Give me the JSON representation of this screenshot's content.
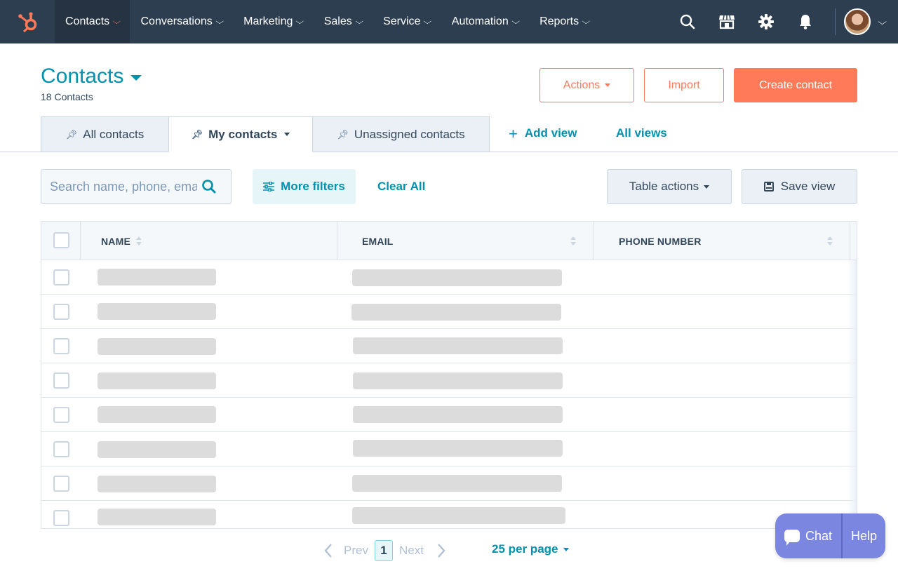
{
  "nav": {
    "items": [
      {
        "label": "Contacts",
        "active": true
      },
      {
        "label": "Conversations"
      },
      {
        "label": "Marketing"
      },
      {
        "label": "Sales"
      },
      {
        "label": "Service"
      },
      {
        "label": "Automation"
      },
      {
        "label": "Reports"
      }
    ],
    "chevron": "⌵",
    "icons": [
      "search-icon",
      "marketplace-icon",
      "settings-icon",
      "notifications-icon"
    ],
    "accent": "#ff7a59",
    "background": "#2d3e50"
  },
  "header": {
    "title": "Contacts",
    "count": "18 Contacts",
    "actions_label": "Actions",
    "import_label": "Import",
    "create_label": "Create contact"
  },
  "tabs": [
    {
      "label": "All contacts"
    },
    {
      "label": "My contacts",
      "active": true
    },
    {
      "label": "Unassigned contacts"
    }
  ],
  "add_view_label": "Add view",
  "all_views_label": "All views",
  "filters": {
    "search_placeholder": "Search name, phone, email",
    "more_filters_label": "More filters",
    "clear_all_label": "Clear All",
    "table_actions_label": "Table actions",
    "save_view_label": "Save view"
  },
  "table": {
    "columns": [
      "NAME",
      "EMAIL",
      "PHONE NUMBER"
    ],
    "row_count_visible": 8,
    "loading": true
  },
  "pagination": {
    "prev_label": "Prev",
    "current_page": "1",
    "next_label": "Next",
    "per_page_label": "25 per page"
  },
  "chat_widget": {
    "chat_label": "Chat",
    "help_label": "Help",
    "color": "#7b86e0"
  }
}
